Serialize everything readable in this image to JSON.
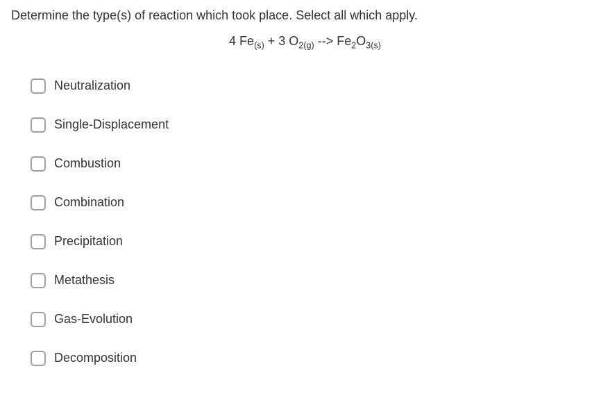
{
  "question": {
    "prompt": "Determine the type(s) of reaction which took place.  Select all which apply.",
    "equation_parts": {
      "coef1": "4 Fe",
      "sub1": "(s)",
      "plus": "  +  3 O",
      "sub2": "2(g)",
      "arrow": "  -->  Fe",
      "sub3": "2",
      "mid": "O",
      "sub4": "3(s)"
    }
  },
  "options": [
    {
      "label": "Neutralization"
    },
    {
      "label": "Single-Displacement"
    },
    {
      "label": "Combustion"
    },
    {
      "label": "Combination"
    },
    {
      "label": "Precipitation"
    },
    {
      "label": "Metathesis"
    },
    {
      "label": "Gas-Evolution"
    },
    {
      "label": "Decomposition"
    }
  ]
}
